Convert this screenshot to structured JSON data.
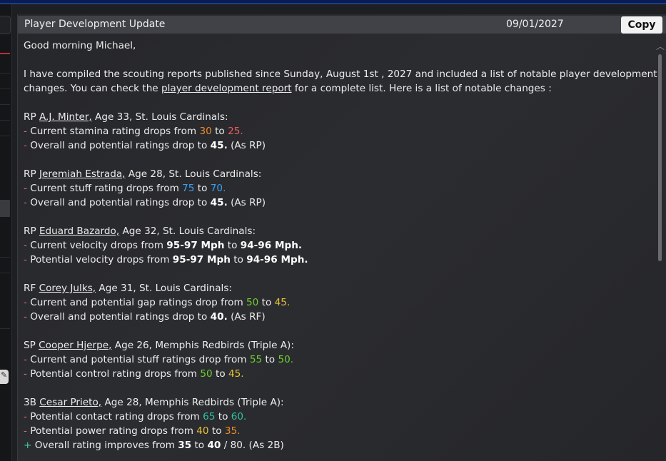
{
  "window": {
    "title": "Player Development Update",
    "date": "09/01/2027",
    "copy_label": "Copy"
  },
  "message": {
    "greeting": "Good morning Michael,",
    "intro_1": "I have compiled the scouting reports published since Sunday, August 1st , 2027 and included a list of notable player development",
    "intro_2a": "changes. You can check the ",
    "intro_link": "player development report",
    "intro_2b": " for a complete list. Here is a list of notable changes :"
  },
  "players": [
    {
      "pos": "RP ",
      "name": "A.J. Minter,",
      "info": " Age 33, St. Louis Cardinals:",
      "lines": [
        {
          "sign": "- ",
          "text": "Current stamina rating drops from ",
          "v1": "30",
          "mid": " to ",
          "v2": "25.",
          "after": ""
        },
        {
          "sign": "- ",
          "text": "Overall and potential ratings drop to ",
          "bold": "45.",
          "after": " (As RP)"
        }
      ]
    },
    {
      "pos": "RP ",
      "name": "Jeremiah Estrada,",
      "info": " Age 28, St. Louis Cardinals:",
      "lines": [
        {
          "sign": "- ",
          "text": "Current stuff rating drops from ",
          "v1": "75",
          "mid": " to ",
          "v2": "70.",
          "after": ""
        },
        {
          "sign": "- ",
          "text": "Overall and potential ratings drop to ",
          "bold": "45.",
          "after": " (As RP)"
        }
      ]
    },
    {
      "pos": "RP ",
      "name": "Eduard Bazardo,",
      "info": " Age 32, St. Louis Cardinals:",
      "lines": [
        {
          "sign": "- ",
          "text": "Current velocity drops from ",
          "v1": "95-97 Mph",
          "mid": " to ",
          "v2": "94-96 Mph."
        },
        {
          "sign": "- ",
          "text": "Potential velocity drops from ",
          "v1": "95-97 Mph",
          "mid": " to ",
          "v2": "94-96 Mph."
        }
      ]
    },
    {
      "pos": "RF ",
      "name": "Corey Julks,",
      "info": " Age 31, St. Louis Cardinals:",
      "lines": [
        {
          "sign": "- ",
          "text": "Current and potential gap ratings drop from ",
          "v1": "50",
          "mid": " to ",
          "v2": "45."
        },
        {
          "sign": "- ",
          "text": "Overall and potential ratings drop to ",
          "bold": "40.",
          "after": " (As RF)"
        }
      ]
    },
    {
      "pos": "SP ",
      "name": "Cooper Hjerpe,",
      "info": " Age 26, Memphis Redbirds (Triple A):",
      "lines": [
        {
          "sign": "- ",
          "text": "Current and potential stuff ratings drop from ",
          "v1": "55",
          "mid": " to ",
          "v2": "50."
        },
        {
          "sign": "- ",
          "text": "Potential control rating drops from ",
          "v1": "50",
          "mid": " to ",
          "v2": "45."
        }
      ]
    },
    {
      "pos": "3B ",
      "name": "Cesar Prieto,",
      "info": " Age 28, Memphis Redbirds (Triple A):",
      "lines": [
        {
          "sign": "- ",
          "text": "Potential contact rating drops from ",
          "v1": "65",
          "mid": " to ",
          "v2": "60."
        },
        {
          "sign": "- ",
          "text": "Potential power rating drops from ",
          "v1": "40",
          "mid": " to ",
          "v2": "35."
        },
        {
          "sign": "+ ",
          "text": "Overall rating improves from ",
          "v1": "35",
          "mid": " to ",
          "v2": "40",
          "after": " / 80. (As 2B)"
        }
      ]
    }
  ],
  "colors": {
    "orange": "#f08a2a",
    "red": "#ef5a5a",
    "blue": "#3aa0f0",
    "green": "#6fcf2f",
    "yellow": "#e6c23a",
    "teal": "#2fc0a0",
    "minus": "#e07070",
    "plus": "#3fd0a0"
  }
}
